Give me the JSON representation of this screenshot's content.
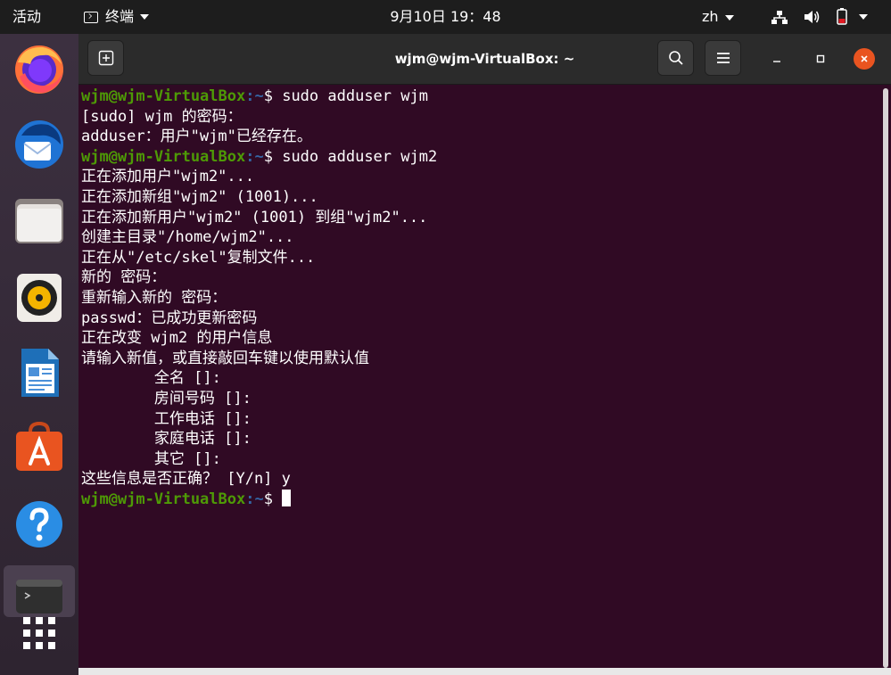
{
  "topbar": {
    "activities": "活动",
    "app_name": "终端",
    "clock": "9月10日  19：48",
    "lang": "zh"
  },
  "window": {
    "title": "wjm@wjm-VirtualBox: ~"
  },
  "terminal": {
    "prompt_user": "wjm@wjm-VirtualBox",
    "prompt_path": ":~",
    "prompt_symbol": "$ ",
    "lines": [
      {
        "type": "prompt",
        "cmd": "sudo adduser wjm"
      },
      {
        "type": "out",
        "text": "[sudo] wjm 的密码："
      },
      {
        "type": "out",
        "text": "adduser：用户\"wjm\"已经存在。"
      },
      {
        "type": "prompt",
        "cmd": "sudo adduser wjm2"
      },
      {
        "type": "out",
        "text": "正在添加用户\"wjm2\"..."
      },
      {
        "type": "out",
        "text": "正在添加新组\"wjm2\" (1001)..."
      },
      {
        "type": "out",
        "text": "正在添加新用户\"wjm2\" (1001) 到组\"wjm2\"..."
      },
      {
        "type": "out",
        "text": "创建主目录\"/home/wjm2\"..."
      },
      {
        "type": "out",
        "text": "正在从\"/etc/skel\"复制文件..."
      },
      {
        "type": "out",
        "text": "新的 密码："
      },
      {
        "type": "out",
        "text": "重新输入新的 密码："
      },
      {
        "type": "out",
        "text": "passwd：已成功更新密码"
      },
      {
        "type": "out",
        "text": "正在改变 wjm2 的用户信息"
      },
      {
        "type": "out",
        "text": "请输入新值，或直接敲回车键以使用默认值"
      },
      {
        "type": "out",
        "text": "        全名 []:"
      },
      {
        "type": "out",
        "text": "        房间号码 []:"
      },
      {
        "type": "out",
        "text": "        工作电话 []:"
      },
      {
        "type": "out",
        "text": "        家庭电话 []:"
      },
      {
        "type": "out",
        "text": "        其它 []:"
      },
      {
        "type": "out",
        "text": "这些信息是否正确？ [Y/n] y"
      },
      {
        "type": "prompt",
        "cmd": "",
        "cursor": true
      }
    ]
  },
  "dock": {
    "items": [
      {
        "name": "firefox-icon"
      },
      {
        "name": "thunderbird-icon"
      },
      {
        "name": "files-icon"
      },
      {
        "name": "rhythmbox-icon"
      },
      {
        "name": "writer-icon"
      },
      {
        "name": "software-icon"
      },
      {
        "name": "help-icon"
      },
      {
        "name": "terminal-icon"
      }
    ]
  },
  "colors": {
    "terminal_bg": "#300a24",
    "prompt_user": "#4e9a06",
    "prompt_path": "#3465a4",
    "close_button": "#e95420"
  }
}
